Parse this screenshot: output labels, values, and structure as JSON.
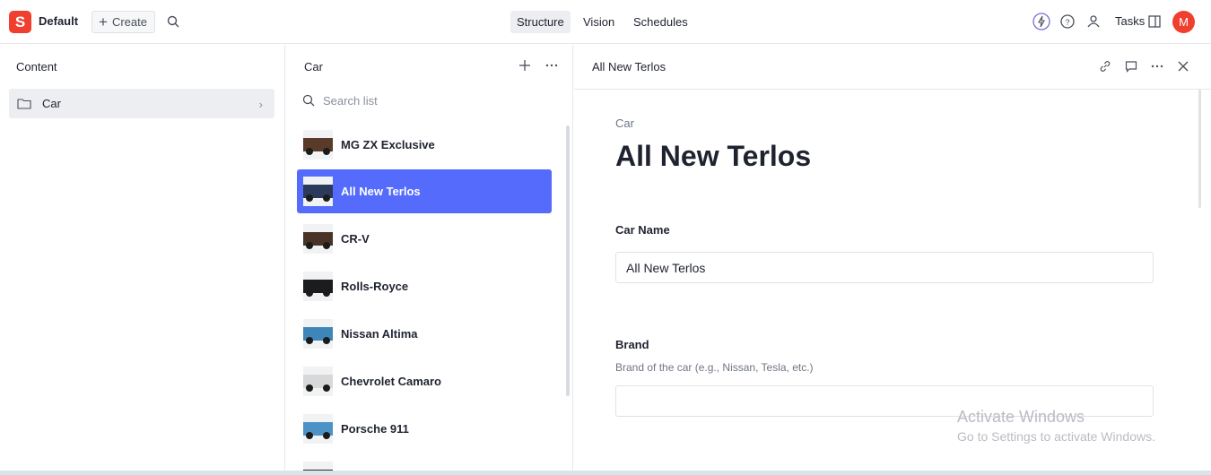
{
  "workspace": {
    "logo_letter": "S",
    "name": "Default"
  },
  "toolbar": {
    "create_label": "Create"
  },
  "nav": {
    "tabs": [
      {
        "label": "Structure",
        "active": true
      },
      {
        "label": "Vision"
      },
      {
        "label": "Schedules"
      }
    ]
  },
  "header_right": {
    "tasks_label": "Tasks",
    "avatar_initial": "M"
  },
  "content_pane": {
    "title": "Content",
    "items": [
      {
        "label": "Car"
      }
    ]
  },
  "list_pane": {
    "title": "Car",
    "search_placeholder": "Search list",
    "items": [
      {
        "name": "MG ZX Exclusive",
        "color": "#5a3a28"
      },
      {
        "name": "All New Terlos",
        "color": "#2b3a5a",
        "selected": true
      },
      {
        "name": "CR-V",
        "color": "#4a3226"
      },
      {
        "name": "Rolls-Royce",
        "color": "#1c1c1f"
      },
      {
        "name": "Nissan Altima",
        "color": "#3f86b8"
      },
      {
        "name": "Chevrolet Camaro",
        "color": "#d8d8d8"
      },
      {
        "name": "Porsche 911",
        "color": "#4c92c6"
      },
      {
        "name": "",
        "color": "#2a2a2a"
      }
    ]
  },
  "document": {
    "header_title": "All New Terlos",
    "type_label": "Car",
    "title": "All New Terlos",
    "fields": [
      {
        "label": "Car Name",
        "description": "",
        "value": "All New Terlos"
      },
      {
        "label": "Brand",
        "description": "Brand of the car (e.g., Nissan, Tesla, etc.)",
        "value": ""
      }
    ]
  },
  "watermark": {
    "line1": "Activate Windows",
    "line2": "Go to Settings to activate Windows."
  },
  "colors": {
    "brand": "#f03e2f",
    "selection": "#556bfc"
  }
}
